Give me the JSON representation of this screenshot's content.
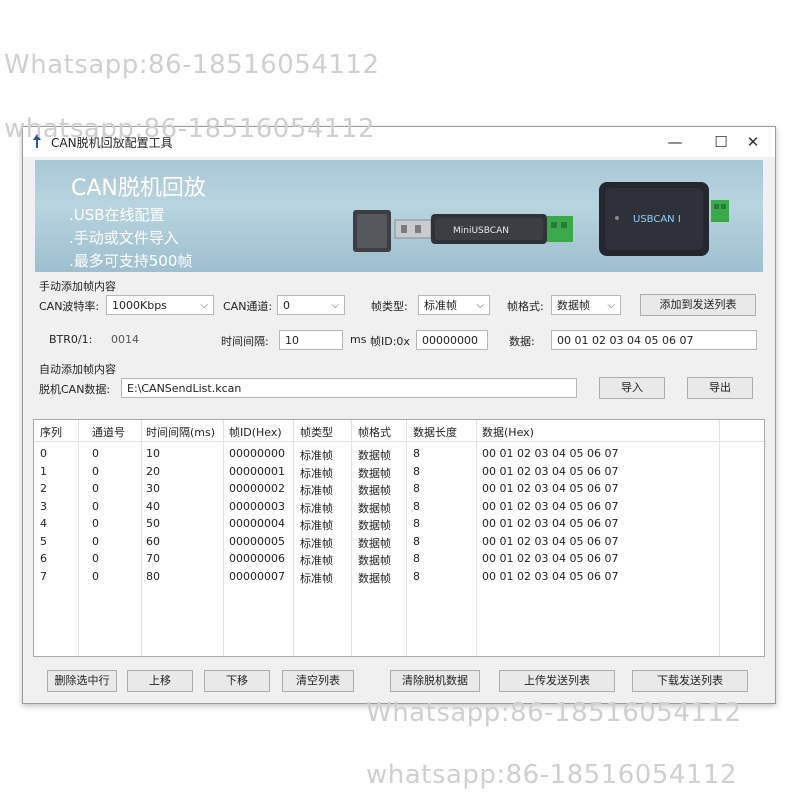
{
  "watermarks": [
    "Whatsapp:86-18516054112",
    "whatsapp:86-18516054112",
    "Whatsapp:86-18516054112",
    "whatsapp:86-18516054112"
  ],
  "window": {
    "title": "CAN脱机回放配置工具",
    "controls": {
      "minimize": "—",
      "maximize": "☐",
      "close": "✕"
    }
  },
  "banner": {
    "title": "CAN脱机回放",
    "lines": [
      ".USB在线配置",
      ".手动或文件导入",
      ".最多可支持500帧"
    ],
    "device1_label": "MiniUSBCAN",
    "device2_label": "USBCAN I"
  },
  "manual": {
    "section_label": "手动添加帧内容",
    "baud_label": "CAN波特率:",
    "baud_value": "1000Kbps",
    "channel_label": "CAN通道:",
    "channel_value": "0",
    "frame_type_label": "帧类型:",
    "frame_type_value": "标准帧",
    "frame_format_label": "帧格式:",
    "frame_format_value": "数据帧",
    "add_button": "添加到发送列表",
    "btr_label": "BTR0/1:",
    "btr_value": "0014",
    "interval_label": "时间间隔:",
    "interval_value": "10",
    "interval_unit": "ms",
    "frame_id_label": "帧ID:0x",
    "frame_id_value": "00000000",
    "data_label": "数据:",
    "data_value": "00 01 02 03 04 05 06 07"
  },
  "auto": {
    "section_label": "自动添加帧内容",
    "file_label": "脱机CAN数据:",
    "file_value": "E:\\CANSendList.kcan",
    "import_button": "导入",
    "export_button": "导出"
  },
  "table": {
    "headers": [
      "序列",
      "通道号",
      "时间间隔(ms)",
      "帧ID(Hex)",
      "帧类型",
      "帧格式",
      "数据长度",
      "数据(Hex)"
    ],
    "rows": [
      [
        "0",
        "0",
        "10",
        "00000000",
        "标准帧",
        "数据帧",
        "8",
        "00 01 02 03 04 05 06 07"
      ],
      [
        "1",
        "0",
        "20",
        "00000001",
        "标准帧",
        "数据帧",
        "8",
        "00 01 02 03 04 05 06 07"
      ],
      [
        "2",
        "0",
        "30",
        "00000002",
        "标准帧",
        "数据帧",
        "8",
        "00 01 02 03 04 05 06 07"
      ],
      [
        "3",
        "0",
        "40",
        "00000003",
        "标准帧",
        "数据帧",
        "8",
        "00 01 02 03 04 05 06 07"
      ],
      [
        "4",
        "0",
        "50",
        "00000004",
        "标准帧",
        "数据帧",
        "8",
        "00 01 02 03 04 05 06 07"
      ],
      [
        "5",
        "0",
        "60",
        "00000005",
        "标准帧",
        "数据帧",
        "8",
        "00 01 02 03 04 05 06 07"
      ],
      [
        "6",
        "0",
        "70",
        "00000006",
        "标准帧",
        "数据帧",
        "8",
        "00 01 02 03 04 05 06 07"
      ],
      [
        "7",
        "0",
        "80",
        "00000007",
        "标准帧",
        "数据帧",
        "8",
        "00 01 02 03 04 05 06 07"
      ]
    ]
  },
  "bottom_buttons": {
    "delete_selected": "删除选中行",
    "move_up": "上移",
    "move_down": "下移",
    "clear_list": "清空列表",
    "clear_offline": "清除脱机数据",
    "upload": "上传发送列表",
    "download": "下载发送列表"
  }
}
